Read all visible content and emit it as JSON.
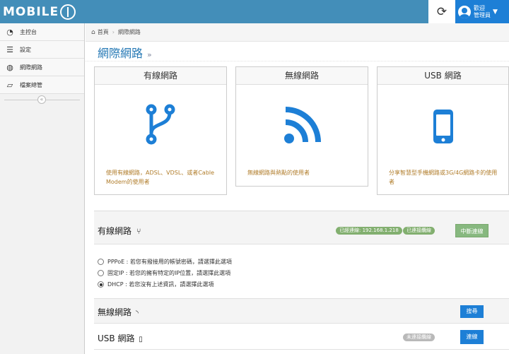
{
  "header": {
    "logo_text": "MOBILE",
    "user_greeting": "歡迎",
    "user_name": "管理員"
  },
  "sidebar": {
    "items": [
      {
        "label": "主控台",
        "icon": "tachometer-icon"
      },
      {
        "label": "設定",
        "icon": "list-icon"
      },
      {
        "label": "網際網路",
        "icon": "globe-icon"
      },
      {
        "label": "檔案總管",
        "icon": "folder-open-icon"
      }
    ],
    "collapse_symbol": "«"
  },
  "breadcrumb": {
    "home": "首頁",
    "current": "網際網路"
  },
  "page": {
    "title": "網際網路",
    "title_chevron": "»"
  },
  "cards": [
    {
      "title": "有線網路",
      "icon": "code-fork-icon",
      "description": "使用有線網路，ADSL、VDSL、或者Cable Modem的使用者"
    },
    {
      "title": "無線網路",
      "icon": "wifi-rss-icon",
      "description": "無線網路與熱點的使用者"
    },
    {
      "title": "USB 網路",
      "icon": "mobile-phone-icon",
      "description": "分享智慧型手機網路或3G/4G網路卡的使用者"
    }
  ],
  "wired_panel": {
    "title": "有線網路",
    "status_ip": "已經連線: 192.168.1.218",
    "status_connected": "已連接纜線",
    "disconnect_label": "中斷連線",
    "options": [
      {
        "label": "PPPoE : 若您有撥接用的帳號密碼，請選擇此選項",
        "selected": false
      },
      {
        "label": "固定IP : 若您的擁有特定的IP位置，請選擇此選項",
        "selected": false
      },
      {
        "label": "DHCP : 若您沒有上述資訊，請選擇此選項",
        "selected": true
      }
    ]
  },
  "wireless_panel": {
    "title": "無線網路",
    "search_label": "搜尋"
  },
  "usb_panel": {
    "title": "USB 網路",
    "status": "未連接纜線",
    "connect_label": "連線"
  },
  "colors": {
    "navbar": "#438eb9",
    "user_box": "#1d7fd6",
    "icon_blue": "#1d7fd6",
    "desc_text": "#b07c2a",
    "badge_green": "#82af6f",
    "badge_gray": "#b9b9b9",
    "btn_green": "#87b87f",
    "btn_blue": "#1d7fd6"
  }
}
